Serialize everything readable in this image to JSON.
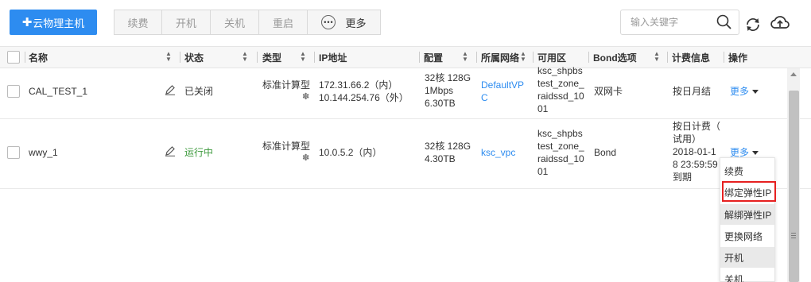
{
  "toolbar": {
    "create_label": "云物理主机",
    "actions": [
      {
        "label": "续费"
      },
      {
        "label": "开机"
      },
      {
        "label": "关机"
      },
      {
        "label": "重启"
      }
    ],
    "more_label": "更多",
    "search": {
      "placeholder": "输入关键字",
      "value": ""
    }
  },
  "table": {
    "columns": [
      {
        "label": "名称"
      },
      {
        "label": "状态"
      },
      {
        "label": "类型"
      },
      {
        "label": "IP地址"
      },
      {
        "label": "配置"
      },
      {
        "label": "所属网络"
      },
      {
        "label": "可用区"
      },
      {
        "label": "Bond选项"
      },
      {
        "label": "计费信息"
      },
      {
        "label": "操作"
      }
    ],
    "rows": [
      {
        "name": "CAL_TEST_1",
        "status": "已关闭",
        "type": "标准计算型",
        "ip_lines": [
          "172.31.66.2（内）",
          "10.144.254.76（外）"
        ],
        "config_lines": [
          "32核 128G",
          "1Mbps",
          "6.30TB"
        ],
        "network_lines": [
          "DefaultVP",
          "C"
        ],
        "zone_lines": [
          "ksc_shpbs",
          "test_zone_",
          "raidssd_10",
          "01"
        ],
        "bond": "双网卡",
        "billing_lines": [
          "按日月结"
        ],
        "action": "更多"
      },
      {
        "name": "wwy_1",
        "status": "运行中",
        "type": "标准计算型",
        "ip_lines": [
          "10.0.5.2（内）"
        ],
        "config_lines": [
          "32核 128G",
          "4.30TB"
        ],
        "network_lines": [
          "ksc_vpc"
        ],
        "zone_lines": [
          "ksc_shpbs",
          "test_zone_",
          "raidssd_10",
          "01"
        ],
        "bond": "Bond",
        "billing_lines": [
          "按日计费（",
          "试用）",
          "2018-01-1",
          "8 23:59:59",
          "到期"
        ],
        "action": "更多"
      }
    ]
  },
  "dropdown": {
    "items": [
      {
        "label": "续费"
      },
      {
        "label": "绑定弹性IP"
      },
      {
        "label": "解绑弹性IP"
      },
      {
        "label": "更换网络"
      },
      {
        "label": "开机"
      },
      {
        "label": "关机"
      }
    ]
  },
  "colors": {
    "primary": "#2d8cf0",
    "link": "#2d8cf0",
    "running": "#3d9a3d",
    "highlight_border": "#e62020"
  }
}
